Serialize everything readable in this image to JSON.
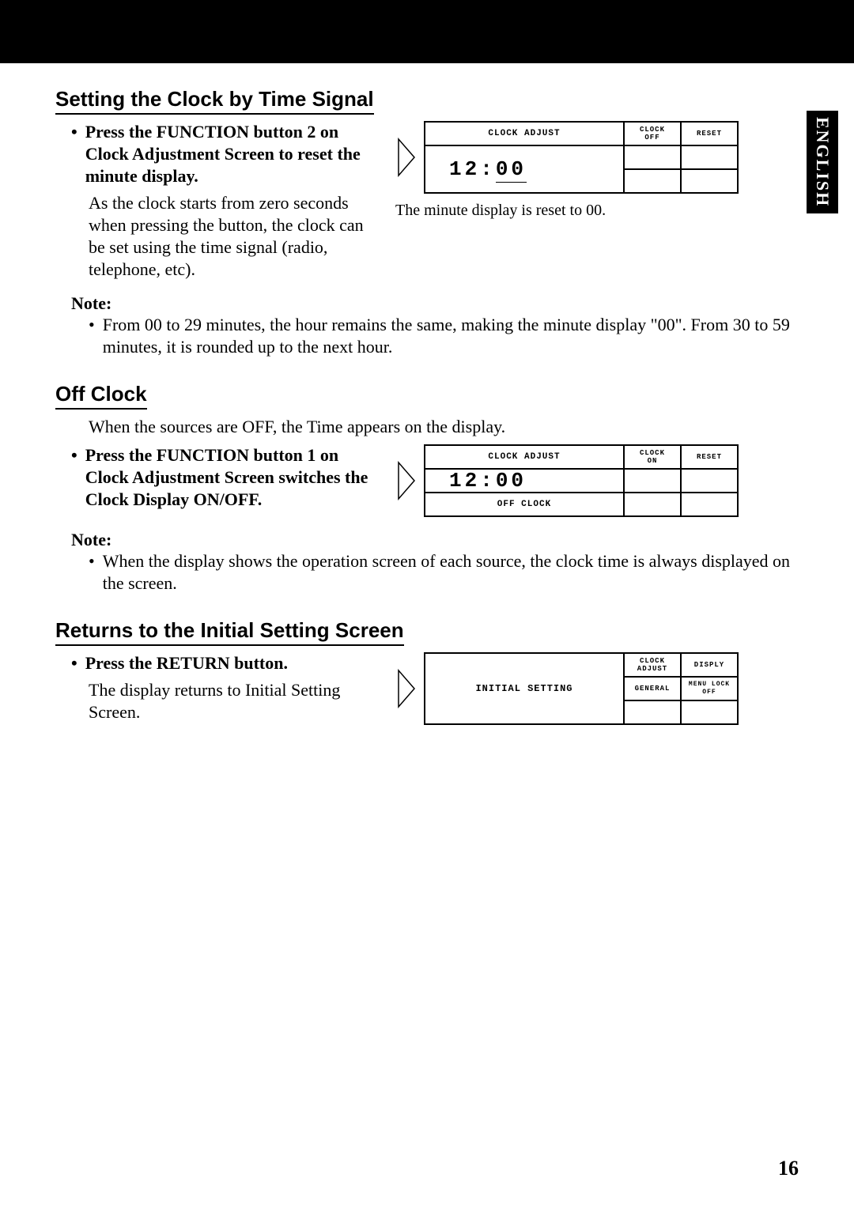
{
  "lang_tab": "ENGLISH",
  "page_number": "16",
  "sec1": {
    "heading": "Setting the Clock by Time Signal",
    "bullet": "Press the FUNCTION button 2 on Clock Adjustment Screen to reset the minute display.",
    "body": "As the clock starts from zero seconds when pressing the button, the clock can be set using the time signal (radio, telephone, etc).",
    "panel": {
      "title": "CLOCK ADJUST",
      "time_h": "12",
      "time_m": "00",
      "btn1_line1": "CLOCK",
      "btn1_line2": "OFF",
      "btn2": "RESET"
    },
    "caption": "The minute display is reset to 00.",
    "note_label": "Note:",
    "note": "From 00 to 29 minutes, the hour remains the same, making the minute display \"00\". From 30 to 59 minutes, it is rounded up to the next hour."
  },
  "sec2": {
    "heading": "Off Clock",
    "intro": "When the sources are OFF, the Time appears on the display.",
    "bullet": "Press the FUNCTION button 1 on Clock Adjustment Screen switches the Clock Display ON/OFF.",
    "panel": {
      "title": "CLOCK ADJUST",
      "time_h": "12",
      "time_m": "00",
      "sub": "OFF CLOCK",
      "btn1_line1": "CLOCK",
      "btn1_line2": "ON",
      "btn2": "RESET"
    },
    "note_label": "Note:",
    "note": "When the display shows the operation screen of each source, the clock time is always displayed on the screen."
  },
  "sec3": {
    "heading": "Returns to the Initial Setting Screen",
    "bullet": "Press the RETURN button.",
    "body": "The display returns to Initial Setting Screen.",
    "panel": {
      "main": "INITIAL SETTING",
      "b1_l1": "CLOCK",
      "b1_l2": "ADJUST",
      "b2": "DISPLY",
      "b3": "GENERAL",
      "b4_l1": "MENU LOCK",
      "b4_l2": "OFF"
    }
  }
}
